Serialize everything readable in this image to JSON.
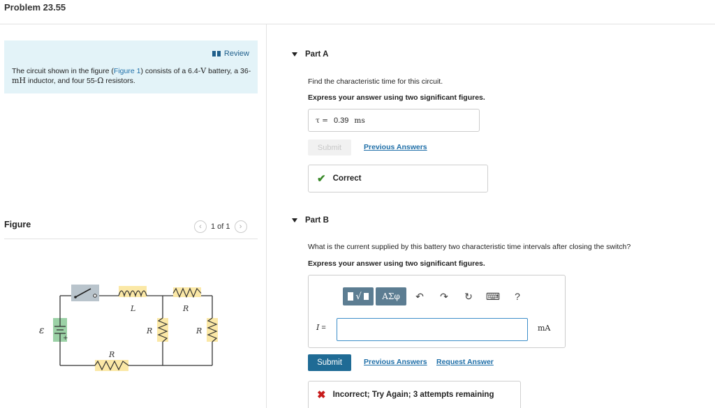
{
  "problem_title": "Problem 23.55",
  "intro": {
    "review_label": "Review",
    "text_pre": "The circuit shown in the figure (",
    "figure_link": "Figure 1",
    "text_mid1": ") consists of a 6.4-",
    "unit_v": "V",
    "text_mid2": " battery, a 36-",
    "unit_mh": "mH",
    "text_mid3": " inductor, and four 55-",
    "unit_ohm": "Ω",
    "text_post": " resistors."
  },
  "figure": {
    "label": "Figure",
    "pager_text": "1 of 1",
    "prev_glyph": "‹",
    "next_glyph": "›",
    "circuit_labels": {
      "emf": "ε",
      "inductor": "L",
      "r_top": "R",
      "r_mid": "R",
      "r_right": "R",
      "r_bottom": "R",
      "plus": "+"
    }
  },
  "part_a": {
    "title": "Part A",
    "question": "Find the characteristic time for this circuit.",
    "note": "Express your answer using two significant figures.",
    "answer_symbol": "τ =",
    "answer_value": "0.39",
    "answer_unit": "ms",
    "submit_label": "Submit",
    "previous_answers_label": "Previous Answers",
    "feedback_icon": "check-icon",
    "feedback_text": "Correct"
  },
  "part_b": {
    "title": "Part B",
    "question": "What is the current supplied by this battery two characteristic time intervals after closing the switch?",
    "note": "Express your answer using two significant figures.",
    "toolbar": {
      "templates_label": "√",
      "greek_label": "ΑΣφ",
      "undo_glyph": "↶",
      "redo_glyph": "↷",
      "reset_glyph": "↻",
      "keyboard_glyph": "⌨",
      "help_glyph": "?"
    },
    "input_label": "I",
    "input_equals": "=",
    "input_value": "",
    "input_unit": "mA",
    "submit_label": "Submit",
    "previous_answers_label": "Previous Answers",
    "request_answer_label": "Request Answer",
    "feedback_icon": "cross-icon",
    "feedback_text": "Incorrect; Try Again; 3 attempts remaining"
  },
  "colors": {
    "intro_bg": "#e3f3f8",
    "link": "#1f6fa8",
    "submit_bg": "#1f6b95",
    "toolbar_bg": "#5c7d92",
    "correct": "#3a8a2a",
    "incorrect": "#c81b1b",
    "resistor_bg": "#fbe8a6",
    "inductor_bg": "#fbe8a6",
    "battery_bg": "#9bd1a6",
    "switch_bg": "#b9c4cc"
  }
}
